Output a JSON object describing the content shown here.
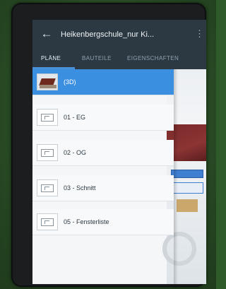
{
  "appbar": {
    "title": "Heikenbergschule_nur Ki...",
    "back_icon": "arrow-back-icon",
    "menu_icon": "more-vert-icon"
  },
  "tabs": [
    {
      "label": "PLÄNE",
      "active": true
    },
    {
      "label": "BAUTEILE",
      "active": false
    },
    {
      "label": "EIGENSCHAFTEN",
      "active": false
    }
  ],
  "plans": [
    {
      "label": "(3D)",
      "selected": true,
      "thumb": "3d-model"
    },
    {
      "label": "01 - EG",
      "selected": false,
      "thumb": "floor-plan"
    },
    {
      "label": "02 - OG",
      "selected": false,
      "thumb": "floor-plan"
    },
    {
      "label": "03 - Schnitt",
      "selected": false,
      "thumb": "section"
    },
    {
      "label": "05 - Fensterliste",
      "selected": false,
      "thumb": "window-list"
    }
  ],
  "colors": {
    "appbar": "#2c3943",
    "accent": "#3b8fe0"
  }
}
